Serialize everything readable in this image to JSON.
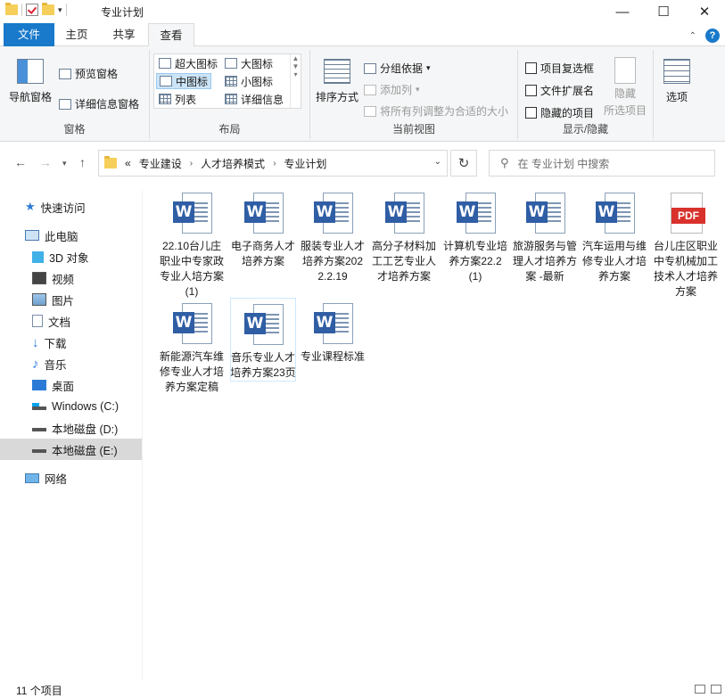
{
  "window": {
    "title": "专业计划",
    "controls": {
      "minimize": "—",
      "maximize": "☐",
      "close": "✕"
    }
  },
  "tabs": [
    {
      "label": "文件"
    },
    {
      "label": "主页"
    },
    {
      "label": "共享"
    },
    {
      "label": "查看"
    }
  ],
  "ribbon": {
    "panes": {
      "label": "窗格",
      "nav_pane": "导航窗格",
      "preview_pane": "预览窗格",
      "details_pane": "详细信息窗格"
    },
    "layout": {
      "label": "布局",
      "items": [
        "超大图标",
        "大图标",
        "中图标",
        "小图标",
        "列表",
        "详细信息"
      ],
      "selected": "中图标"
    },
    "current_view": {
      "label": "当前视图",
      "sort_by": "排序方式",
      "group_by": "分组依据",
      "add_columns": "添加列",
      "size_columns": "将所有列调整为合适的大小"
    },
    "show_hide": {
      "label": "显示/隐藏",
      "item_checkboxes": "项目复选框",
      "file_extensions": "文件扩展名",
      "hidden_items": "隐藏的项目",
      "hide": "隐藏",
      "hide_selected": "所选项目"
    },
    "options": "选项"
  },
  "address": {
    "prefix": "«",
    "crumbs": [
      "专业建设",
      "人才培养模式",
      "专业计划"
    ],
    "search_placeholder": "在 专业计划 中搜索"
  },
  "sidebar": {
    "items": [
      {
        "label": "快速访问",
        "icon": "star-icon"
      },
      {
        "label": "此电脑",
        "icon": "computer-icon"
      },
      {
        "label": "3D 对象",
        "icon": "cube-icon"
      },
      {
        "label": "视频",
        "icon": "video-icon"
      },
      {
        "label": "图片",
        "icon": "picture-icon"
      },
      {
        "label": "文档",
        "icon": "document-icon"
      },
      {
        "label": "下载",
        "icon": "download-icon"
      },
      {
        "label": "音乐",
        "icon": "music-icon"
      },
      {
        "label": "桌面",
        "icon": "desktop-icon"
      },
      {
        "label": "Windows (C:)",
        "icon": "drive-icon"
      },
      {
        "label": "本地磁盘 (D:)",
        "icon": "drive-icon"
      },
      {
        "label": "本地磁盘 (E:)",
        "icon": "drive-icon"
      },
      {
        "label": "网络",
        "icon": "network-icon"
      }
    ],
    "selected": "本地磁盘 (E:)"
  },
  "files": [
    {
      "name": "22.10台儿庄职业中专家政专业人培方案(1)",
      "type": "word"
    },
    {
      "name": "电子商务人才培养方案",
      "type": "word"
    },
    {
      "name": "服装专业人才培养方案2022.2.19",
      "type": "word"
    },
    {
      "name": "高分子材料加工工艺专业人才培养方案",
      "type": "word"
    },
    {
      "name": "计算机专业培养方案22.2(1)",
      "type": "word"
    },
    {
      "name": "旅游服务与管理人才培养方案 -最新",
      "type": "word"
    },
    {
      "name": "汽车运用与维修专业人才培养方案",
      "type": "word"
    },
    {
      "name": "台儿庄区职业中专机械加工技术人才培养方案",
      "type": "pdf",
      "badge": "PDF"
    },
    {
      "name": "新能源汽车维修专业人才培养方案定稿",
      "type": "word"
    },
    {
      "name": "音乐专业人才培养方案23页",
      "type": "word"
    },
    {
      "name": "专业课程标准",
      "type": "word"
    }
  ],
  "status": {
    "count": "11 个项目"
  }
}
